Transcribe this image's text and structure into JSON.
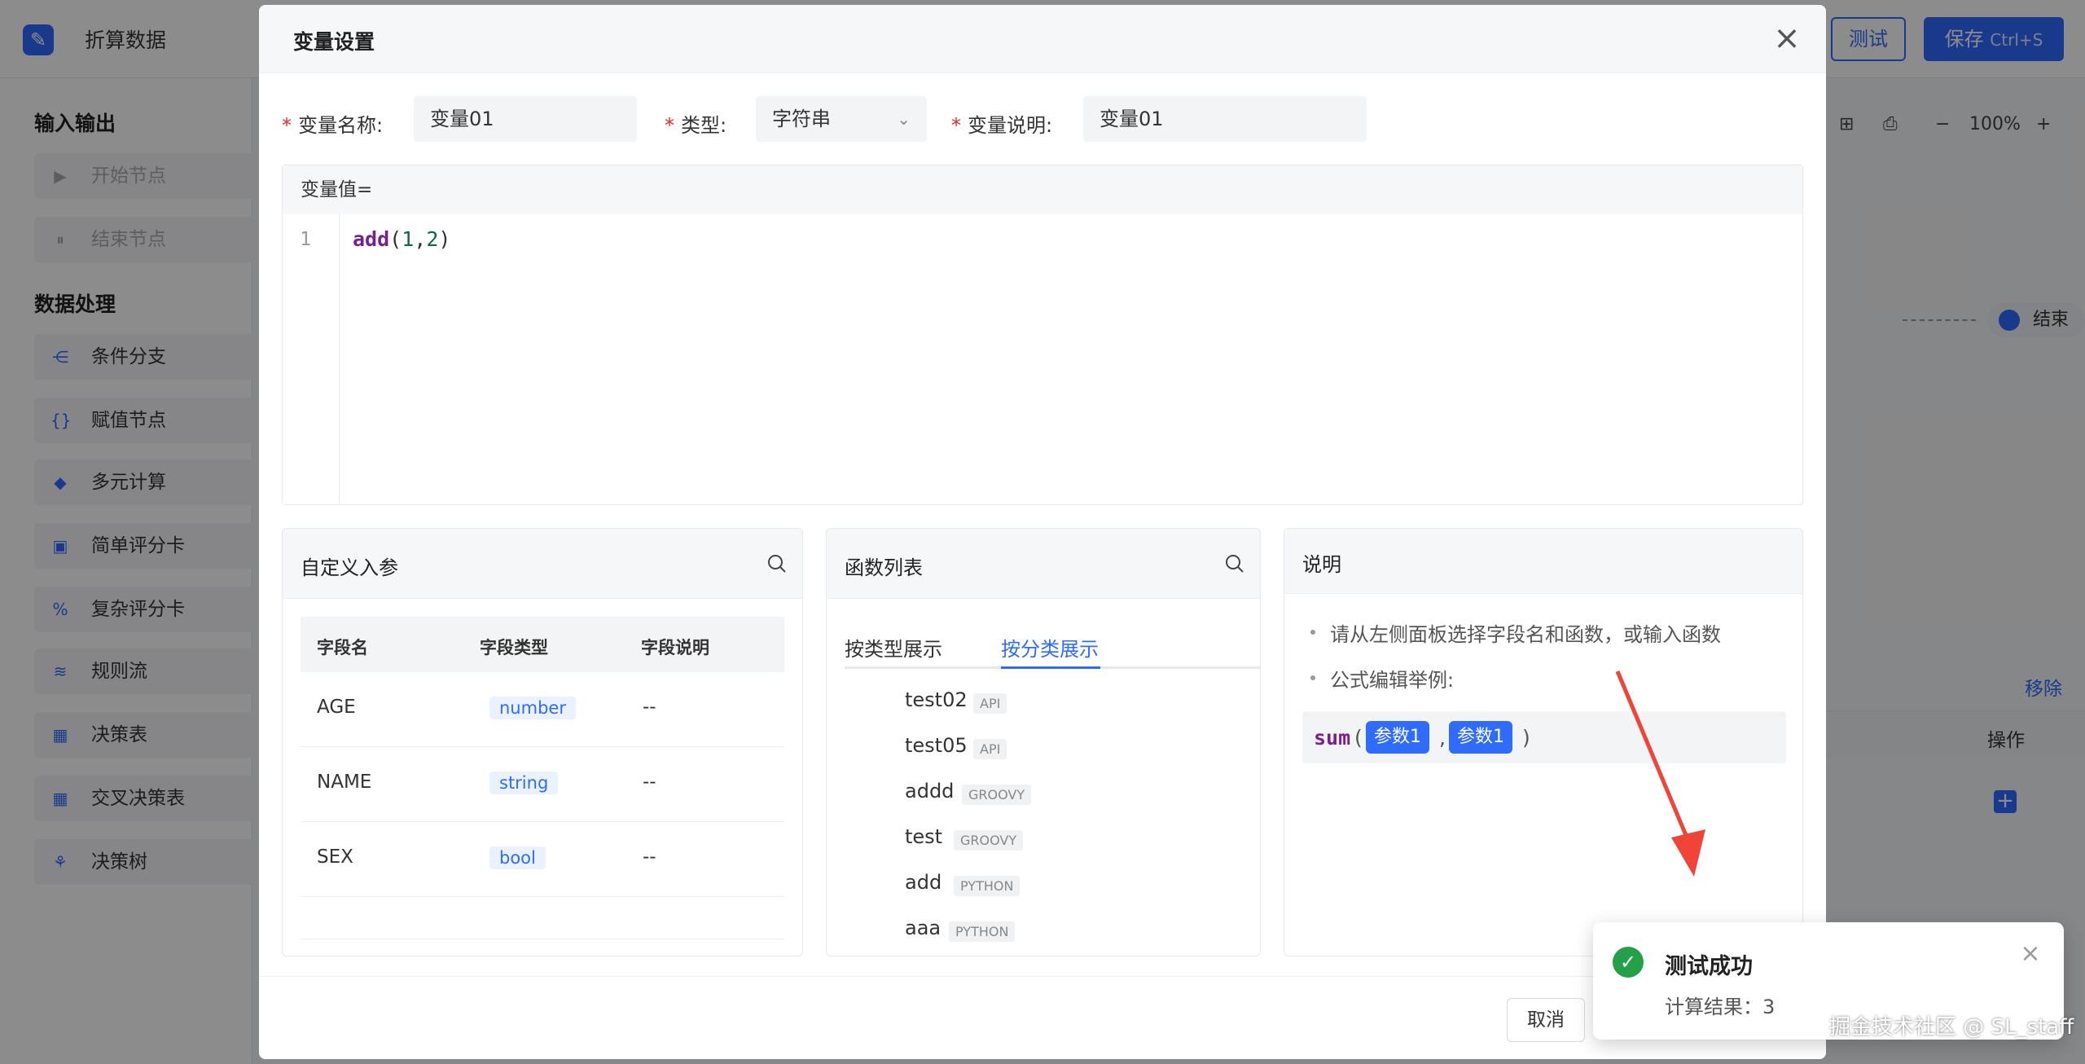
{
  "app": {
    "title": "折算数据",
    "test_label": "测试",
    "save_label": "保存",
    "save_shortcut": "Ctrl+S"
  },
  "sidebar": {
    "groups": [
      {
        "label": "输入输出",
        "items": [
          "开始节点",
          "结束节点"
        ]
      },
      {
        "label": "数据处理",
        "items": [
          "条件分支",
          "赋值节点",
          "多元计算",
          "简单评分卡",
          "复杂评分卡",
          "规则流",
          "决策表",
          "交叉决策表",
          "决策树"
        ]
      }
    ]
  },
  "canvas": {
    "zoom": "100%",
    "end_node": "结束",
    "remove_label": "移除",
    "op_header": "操作"
  },
  "modal": {
    "title": "变量设置",
    "name_label": "变量名称:",
    "name_value": "变量01",
    "type_label": "类型:",
    "type_value": "字符串",
    "desc_label": "变量说明:",
    "desc_value": "变量01",
    "editor_label": "变量值=",
    "line_number": "1",
    "code": {
      "fn": "add",
      "open": "(",
      "arg1": "1",
      "comma": ",",
      "arg2": "2",
      "close": ")"
    },
    "params_panel": {
      "title": "自定义入参",
      "headers": [
        "字段名",
        "字段类型",
        "字段说明"
      ],
      "rows": [
        {
          "name": "AGE",
          "type": "number",
          "desc": "--"
        },
        {
          "name": "NAME",
          "type": "string",
          "desc": "--"
        },
        {
          "name": "SEX",
          "type": "bool",
          "desc": "--"
        }
      ]
    },
    "func_panel": {
      "title": "函数列表",
      "tabs": [
        "按类型展示",
        "按分类展示"
      ],
      "items": [
        {
          "name": "test02",
          "tag": "API"
        },
        {
          "name": "test05",
          "tag": "API"
        },
        {
          "name": "addd",
          "tag": "GROOVY"
        },
        {
          "name": "test",
          "tag": "GROOVY"
        },
        {
          "name": "add",
          "tag": "PYTHON"
        },
        {
          "name": "aaa",
          "tag": "PYTHON"
        }
      ]
    },
    "desc_panel": {
      "title": "说明",
      "items": [
        "请从左侧面板选择字段名和函数，或输入函数",
        "公式编辑举例:"
      ],
      "example": {
        "fn": "sum",
        "open": "(",
        "param1": "参数1",
        "comma": ",",
        "param2": "参数1",
        "close": ")"
      }
    },
    "cancel_label": "取消"
  },
  "toast": {
    "title": "测试成功",
    "body": "计算结果：3"
  },
  "watermark": "掘金技术社区 @ SL_staff",
  "colors": {
    "primary": "#2f6bff",
    "success": "#24a148",
    "danger": "#f5222d",
    "arrow": "#f04438"
  }
}
